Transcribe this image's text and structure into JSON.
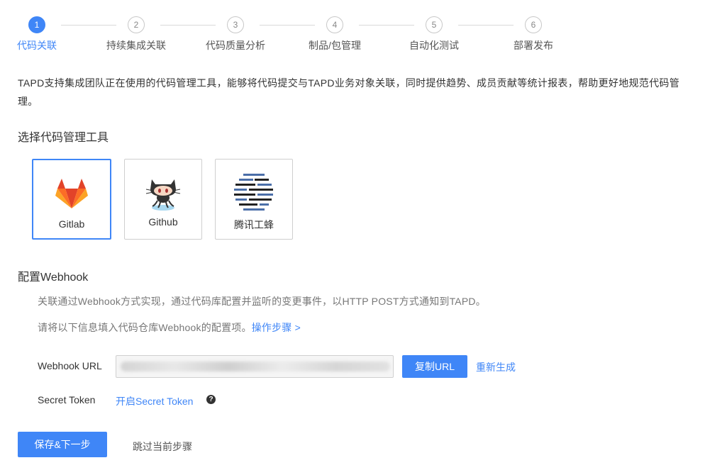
{
  "steps": [
    {
      "num": "1",
      "label": "代码关联"
    },
    {
      "num": "2",
      "label": "持续集成关联"
    },
    {
      "num": "3",
      "label": "代码质量分析"
    },
    {
      "num": "4",
      "label": "制品/包管理"
    },
    {
      "num": "5",
      "label": "自动化测试"
    },
    {
      "num": "6",
      "label": "部署发布"
    }
  ],
  "intro": "TAPD支持集成团队正在使用的代码管理工具，能够将代码提交与TAPD业务对象关联，同时提供趋势、成员贡献等统计报表，帮助更好地规范代码管理。",
  "tools_section": {
    "title": "选择代码管理工具",
    "tools": [
      {
        "name": "Gitlab",
        "icon": "gitlab-logo-icon",
        "selected": true
      },
      {
        "name": "Github",
        "icon": "github-octocat-icon",
        "selected": false
      },
      {
        "name": "腾讯工蜂",
        "icon": "tencent-gongfeng-logo-icon",
        "selected": false
      }
    ]
  },
  "webhook": {
    "title": "配置Webhook",
    "desc1": "关联通过Webhook方式实现，通过代码库配置并监听的变更事件，以HTTP POST方式通知到TAPD。",
    "desc2_prefix": "请将以下信息填入代码仓库Webhook的配置项。",
    "desc2_link": "操作步骤 >",
    "url_label": "Webhook URL",
    "copy_button": "复制URL",
    "regenerate_link": "重新生成",
    "token_label": "Secret Token",
    "token_link": "开启Secret Token",
    "help_glyph": "?"
  },
  "footer": {
    "save_button": "保存&下一步",
    "skip_link": "跳过当前步骤"
  },
  "colors": {
    "accent": "#3f86f7"
  }
}
